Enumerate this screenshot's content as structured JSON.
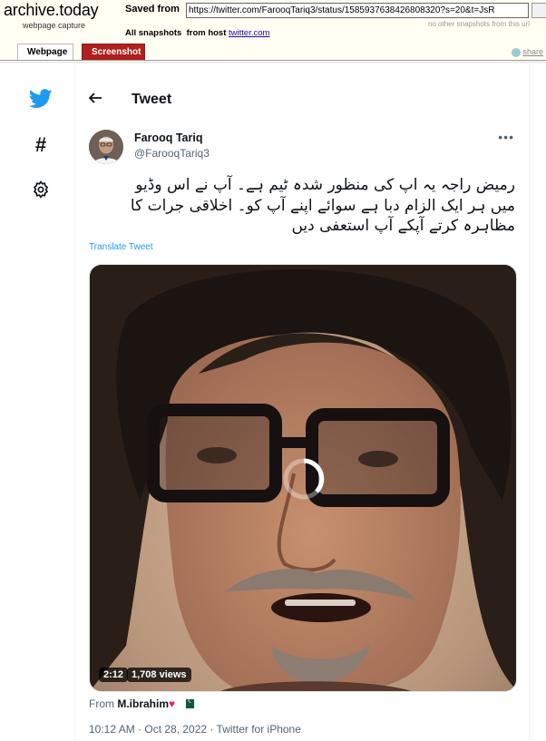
{
  "archive": {
    "logo": "archive.today",
    "logo_sub": "webpage capture",
    "saved_from_label": "Saved from",
    "url": "https://twitter.com/FarooqTariq3/status/1585937638426808320?s=20&t=JsR",
    "no_other": "no other snapshots from this url",
    "all_snapshots_label": "All snapshots",
    "from_host_label": "from host",
    "host": "twitter.com",
    "tabs": [
      {
        "label": "Webpage"
      },
      {
        "label": "Screenshot"
      }
    ],
    "share_label": "share"
  },
  "header": {
    "back_icon": "arrow-left-icon",
    "title": "Tweet"
  },
  "nav": [
    {
      "icon": "twitter-bird-icon",
      "color": "#1d9bf0"
    },
    {
      "icon": "hashtag-icon"
    },
    {
      "icon": "gear-icon"
    }
  ],
  "tweet": {
    "author_name": "Farooq Tariq",
    "author_handle": "@FarooqTariq3",
    "more_icon": "more-dots-icon",
    "text_lines": [
      "رمیض راجہ یہ اپ کی منظور شدہ ٹیم ہے۔ آپ نے اس وڈیو",
      "میں ہر ایک الزام دبا ہے سوائے اپنے آپ کو۔ اخلاقی جرات کا",
      "مظاہرہ کرتے آپکے آپ استعفی دیں"
    ],
    "translate_label": "Translate Tweet",
    "video": {
      "duration": "2:12",
      "views": "1,708 views"
    },
    "from_label": "From",
    "from_user": "M.ibrahim",
    "from_emoji": "♥",
    "timestamp": "10:12 AM · Oct 28, 2022 · Twitter for iPhone"
  },
  "colors": {
    "twitter_blue": "#1d9bf0",
    "screenshot_tab": "#b0201e",
    "archive_bg": "#fffff4"
  }
}
